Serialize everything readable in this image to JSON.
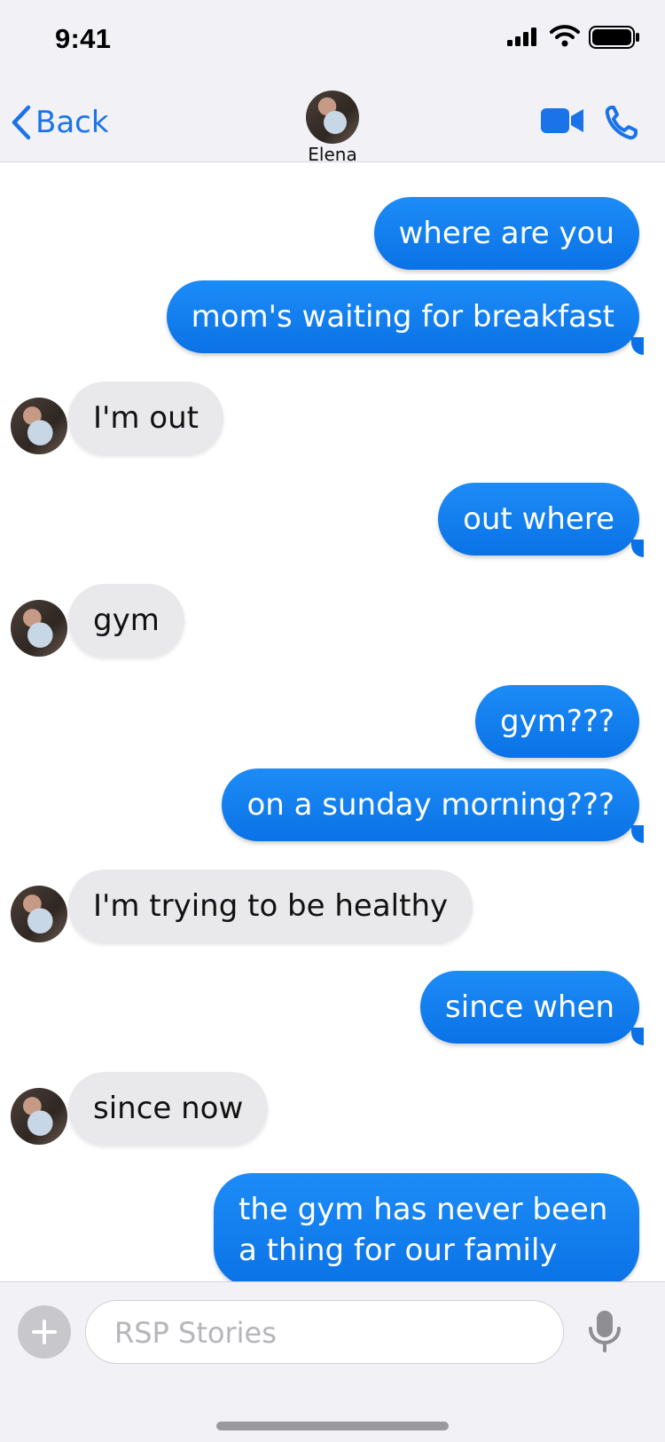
{
  "status": {
    "time": "9:41",
    "signal_icon": "signal-bars-icon",
    "wifi_icon": "wifi-icon",
    "battery_icon": "battery-icon"
  },
  "header": {
    "back_label": "Back",
    "contact_name": "Elena",
    "video_icon": "video-camera-icon",
    "phone_icon": "phone-icon"
  },
  "messages": [
    {
      "from": "me",
      "text": "where are you"
    },
    {
      "from": "me",
      "text": "mom's waiting for breakfast"
    },
    {
      "from": "them",
      "text": "I'm out"
    },
    {
      "from": "me",
      "text": "out where"
    },
    {
      "from": "them",
      "text": "gym"
    },
    {
      "from": "me",
      "text": "gym???"
    },
    {
      "from": "me",
      "text": "on a sunday morning???"
    },
    {
      "from": "them",
      "text": "I'm trying to be healthy"
    },
    {
      "from": "me",
      "text": "since when"
    },
    {
      "from": "them",
      "text": "since now"
    },
    {
      "from": "me",
      "text": "the gym has never been a thing for our family"
    }
  ],
  "composer": {
    "placeholder": "RSP Stories",
    "plus_icon": "plus-icon",
    "mic_icon": "microphone-icon"
  },
  "colors": {
    "accent": "#1a73e8",
    "outgoing": "#0a72e6",
    "incoming": "#e9e9eb"
  }
}
